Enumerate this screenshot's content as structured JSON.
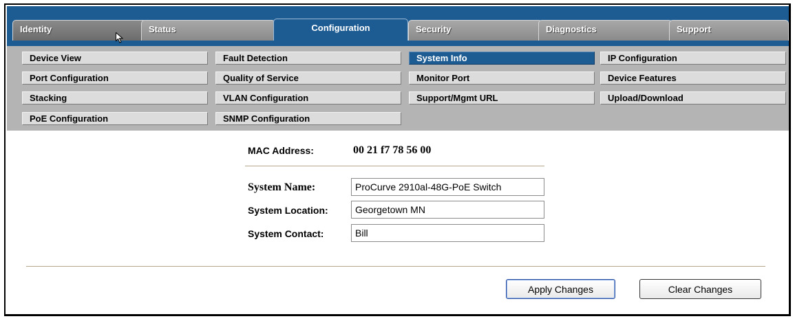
{
  "tabs": [
    {
      "label": "Identity"
    },
    {
      "label": "Status"
    },
    {
      "label": "Configuration"
    },
    {
      "label": "Security"
    },
    {
      "label": "Diagnostics"
    },
    {
      "label": "Support"
    }
  ],
  "subnav": [
    {
      "label": "Device View"
    },
    {
      "label": "Fault Detection"
    },
    {
      "label": "System Info"
    },
    {
      "label": "IP Configuration"
    },
    {
      "label": "Port Configuration"
    },
    {
      "label": "Quality of Service"
    },
    {
      "label": "Monitor Port"
    },
    {
      "label": "Device Features"
    },
    {
      "label": "Stacking"
    },
    {
      "label": "VLAN Configuration"
    },
    {
      "label": "Support/Mgmt URL"
    },
    {
      "label": "Upload/Download"
    },
    {
      "label": "PoE Configuration"
    },
    {
      "label": "SNMP Configuration"
    }
  ],
  "form": {
    "mac_label": "MAC Address:",
    "mac_value": "00 21 f7 78 56 00",
    "name_label": "System Name:",
    "name_value": "ProCurve 2910al-48G-PoE Switch",
    "location_label": "System Location:",
    "location_value": "Georgetown MN",
    "contact_label": "System Contact:",
    "contact_value": "Bill"
  },
  "buttons": {
    "apply": "Apply Changes",
    "clear": "Clear Changes"
  },
  "colors": {
    "brand_blue": "#1d5c93",
    "subnav_bg": "#b4b4b4"
  }
}
